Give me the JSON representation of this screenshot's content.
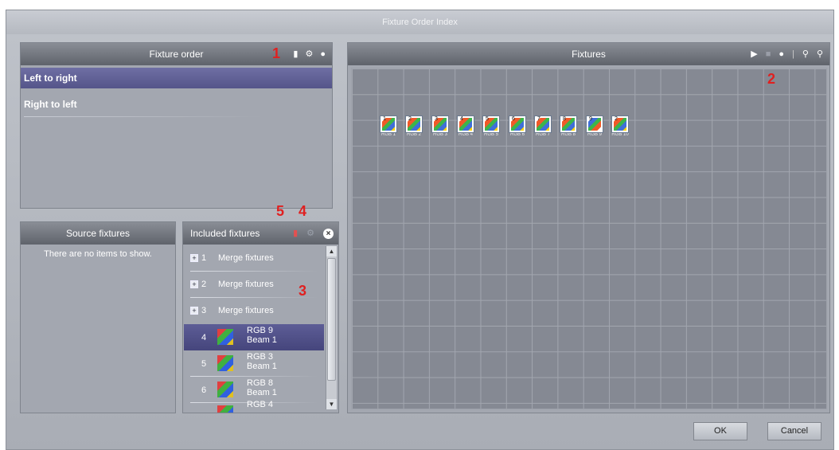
{
  "window": {
    "title": "Fixture Order Index"
  },
  "fixture_order": {
    "title": "Fixture order",
    "items": [
      {
        "label": "Left to right",
        "selected": true
      },
      {
        "label": "Right to left",
        "selected": false
      }
    ],
    "icon_glyphs": [
      "▮",
      "⚙",
      "●"
    ]
  },
  "fixtures": {
    "title": "Fixtures",
    "tiles": [
      {
        "num": "1",
        "label": "RGB 1"
      },
      {
        "num": "2",
        "label": "RGB 2"
      },
      {
        "num": "3",
        "label": "RGB 3"
      },
      {
        "num": "4",
        "label": "RGB 4"
      },
      {
        "num": "5",
        "label": "RGB 5"
      },
      {
        "num": "6",
        "label": "RGB 6"
      },
      {
        "num": "7",
        "label": "RGB 7"
      },
      {
        "num": "8",
        "label": "RGB 8"
      },
      {
        "num": "9",
        "label": "RGB 9"
      },
      {
        "num": "2",
        "label": "RGB 10"
      }
    ]
  },
  "source_fixtures": {
    "title": "Source fixtures",
    "empty_text": "There are no items to show."
  },
  "included_fixtures": {
    "title": "Included fixtures",
    "merge_rows": [
      {
        "num": "1",
        "label": "Merge fixtures"
      },
      {
        "num": "2",
        "label": "Merge fixtures"
      },
      {
        "num": "3",
        "label": "Merge fixtures"
      }
    ],
    "fixture_rows": [
      {
        "num": "4",
        "line1": "RGB  9",
        "line2": "Beam 1",
        "selected": true
      },
      {
        "num": "5",
        "line1": "RGB  3",
        "line2": "Beam 1",
        "selected": false
      },
      {
        "num": "6",
        "line1": "RGB  8",
        "line2": "Beam 1",
        "selected": false
      },
      {
        "num": "",
        "line1": "RGB  4",
        "line2": "",
        "selected": false
      }
    ]
  },
  "annotations": {
    "a1": "1",
    "a2": "2",
    "a3": "3",
    "a4": "4",
    "a5": "5"
  },
  "buttons": {
    "ok": "OK",
    "cancel": "Cancel"
  }
}
